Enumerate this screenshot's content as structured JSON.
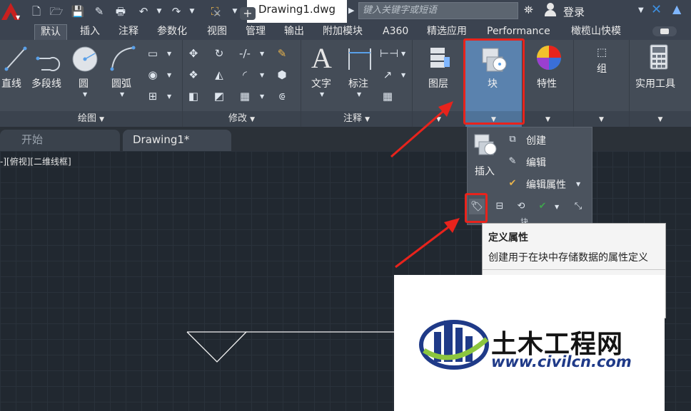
{
  "titlebar": {
    "document_title": "Drawing1.dwg",
    "search_placeholder": "键入关键字或短语",
    "login_label": "登录"
  },
  "ribbon_tabs": [
    "默认",
    "插入",
    "注释",
    "参数化",
    "视图",
    "管理",
    "输出",
    "附加模块",
    "A360",
    "精选应用",
    "Performance",
    "橄榄山快模"
  ],
  "active_tab": "默认",
  "panels": {
    "draw": {
      "title": "绘图",
      "line": "直线",
      "polyline": "多段线",
      "circle": "圆",
      "arc": "圆弧"
    },
    "modify": {
      "title": "修改"
    },
    "annotation": {
      "title": "注释",
      "text": "文字",
      "dimension": "标注"
    },
    "layers": {
      "label": "图层"
    },
    "block": {
      "label": "块"
    },
    "properties": {
      "label": "特性"
    },
    "groups": {
      "label": "组"
    },
    "utilities": {
      "label": "实用工具"
    }
  },
  "file_tabs": {
    "start": "开始",
    "drawing": "Drawing1*"
  },
  "viewport_label": "-][俯视][二维线框]",
  "block_dropdown": {
    "insert": "插入",
    "create": "创建",
    "edit": "编辑",
    "edit_attributes": "编辑属性",
    "footer_partial": "块"
  },
  "tooltip": {
    "title": "定义属性",
    "description": "创建用于在块中存储数据的属性定义"
  },
  "watermark": {
    "name": "土木工程网",
    "url": "www.civilcn.com"
  },
  "colors": {
    "annotation_red": "#e8231c",
    "ribbon_bg": "#444c57",
    "canvas_bg": "#212830"
  }
}
